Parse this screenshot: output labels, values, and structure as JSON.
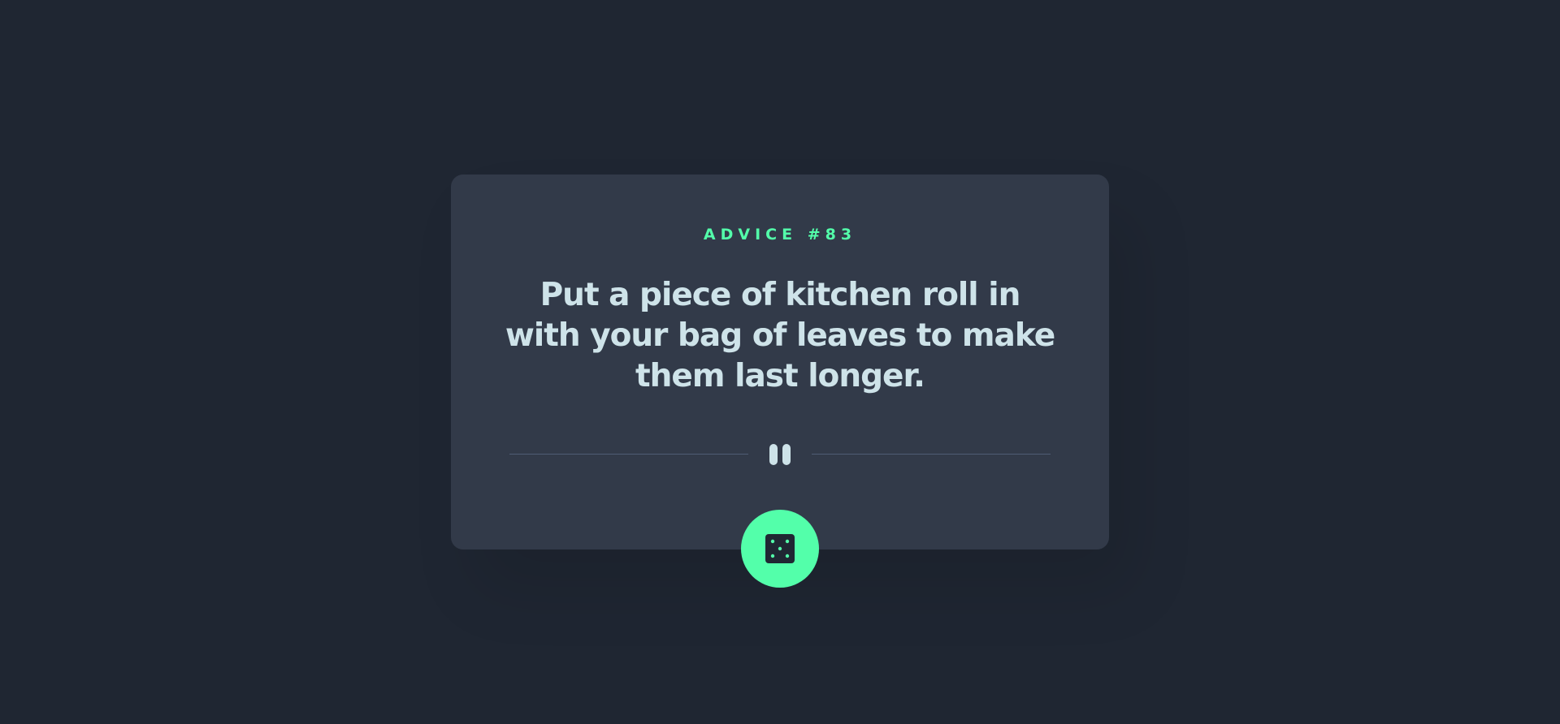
{
  "advice": {
    "id_label": "ADVICE #83",
    "quote": "Put a piece of kitchen roll in with your bag of leaves to make them last longer."
  },
  "icons": {
    "divider": "pause-icon",
    "button": "dice-icon"
  },
  "colors": {
    "background": "#1f2632",
    "card": "#323a49",
    "accent": "#53ffaa",
    "text": "#cee3e9",
    "divider": "#4f5d74"
  }
}
